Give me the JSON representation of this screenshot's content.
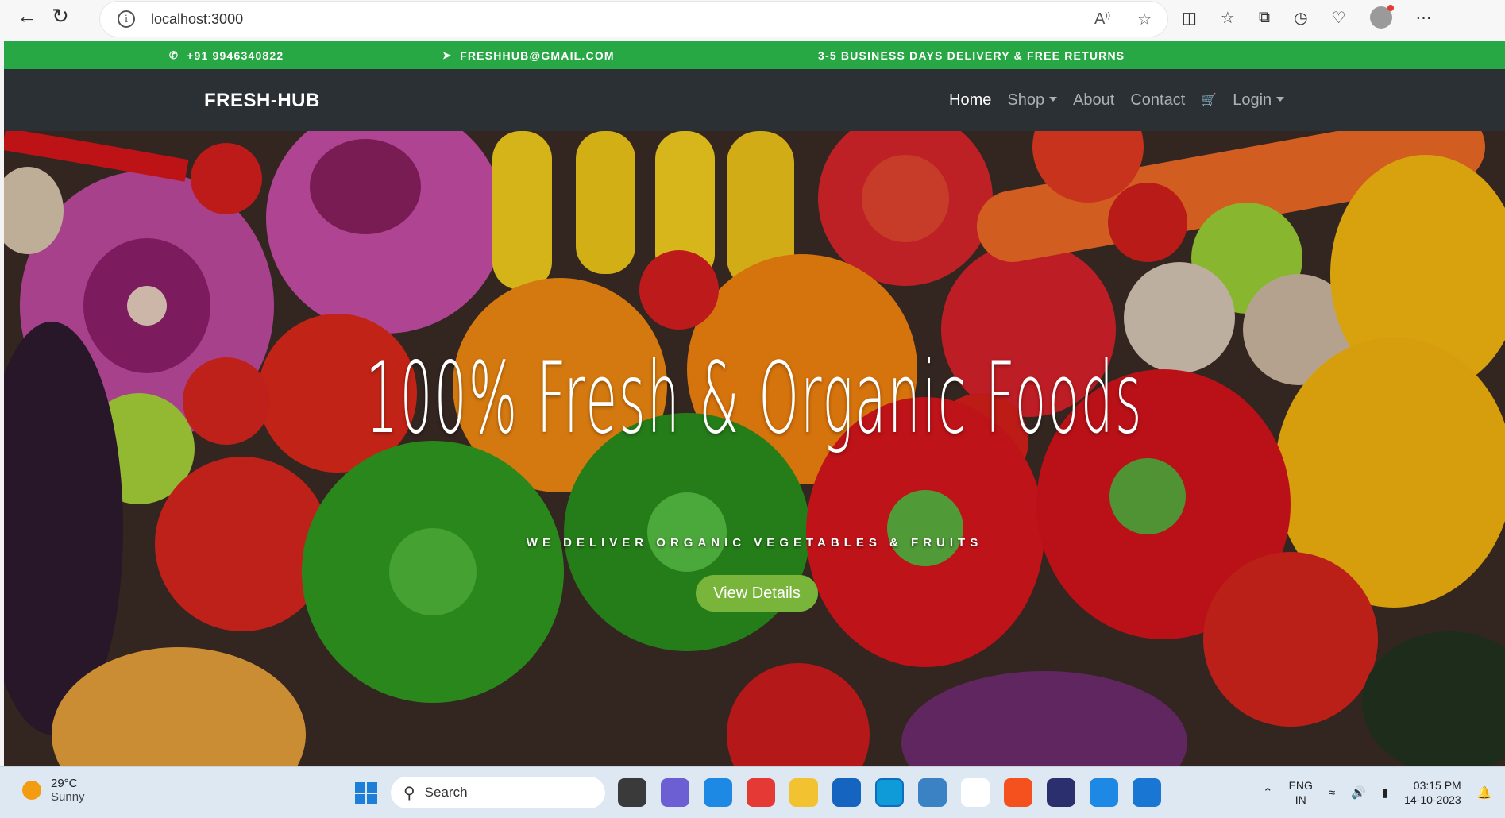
{
  "browser": {
    "url": "localhost:3000",
    "back_icon": "back-arrow-icon",
    "refresh_icon": "refresh-icon"
  },
  "topbar": {
    "phone": "+91 9946340822",
    "email": "FRESHHUB@GMAIL.COM",
    "notice": "3-5 BUSINESS DAYS DELIVERY & FREE RETURNS",
    "color": "#28a745"
  },
  "navbar": {
    "brand": "FRESH-HUB",
    "links": {
      "home": "Home",
      "shop": "Shop",
      "about": "About",
      "contact": "Contact",
      "login": "Login"
    },
    "cart_icon": "cart-icon",
    "background": "#2b3035"
  },
  "hero": {
    "title": "100% Fresh & Organic Foods",
    "subtitle": "WE DELIVER ORGANIC VEGETABLES & FRUITS",
    "button": "View Details",
    "button_color": "#7ab53b"
  },
  "taskbar": {
    "temperature": "29°C",
    "condition": "Sunny",
    "search_label": "Search",
    "language": "ENG",
    "region": "IN",
    "time": "03:15 PM",
    "date": "14-10-2023"
  }
}
